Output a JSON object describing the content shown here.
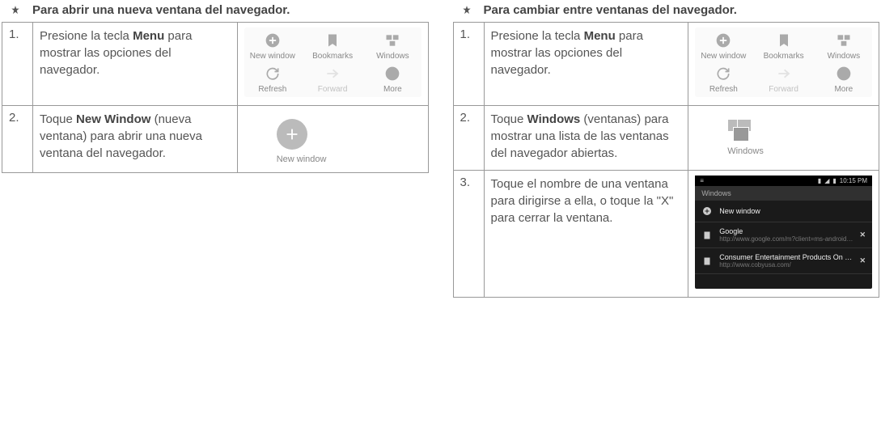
{
  "left": {
    "heading": "Para abrir una nueva ventana del navegador.",
    "steps": [
      {
        "num": "1.",
        "pre": "Presione la tecla ",
        "bold": "Menu",
        "post": " para mostrar las opciones del navegador."
      },
      {
        "num": "2.",
        "pre": "Toque ",
        "bold": "New Window",
        "post": " (nueva ventana) para abrir una nueva ventana del navegador."
      }
    ],
    "single_label": "New window"
  },
  "right": {
    "heading": "Para cambiar entre ventanas del navegador.",
    "steps": [
      {
        "num": "1.",
        "pre": "Presione la tecla ",
        "bold": "Menu",
        "post": " para mostrar las opciones del navegador."
      },
      {
        "num": "2.",
        "pre": "Toque ",
        "bold": "Windows",
        "post": " (ventanas) para mostrar una lista de las ventanas del navegador abiertas."
      },
      {
        "num": "3.",
        "pre": "Toque el nombre de una ventana para dirigirse a ella, o toque la \"X\" para cerrar la ventana.",
        "bold": "",
        "post": ""
      }
    ],
    "single_label": "Windows"
  },
  "menu": {
    "items": [
      {
        "label": "New window"
      },
      {
        "label": "Bookmarks"
      },
      {
        "label": "Windows"
      },
      {
        "label": "Refresh"
      },
      {
        "label": "Forward"
      },
      {
        "label": "More"
      }
    ]
  },
  "phone": {
    "time": "10:15 PM",
    "tab_label": "Windows",
    "newwin": "New window",
    "rows": [
      {
        "title": "Google",
        "url": "http://www.google.com/m?client=ms-android-google&source=android-home"
      },
      {
        "title": "Consumer Entertainment Products On the Go! | COBY Elec…",
        "url": "http://www.cobyusa.com/"
      }
    ]
  }
}
